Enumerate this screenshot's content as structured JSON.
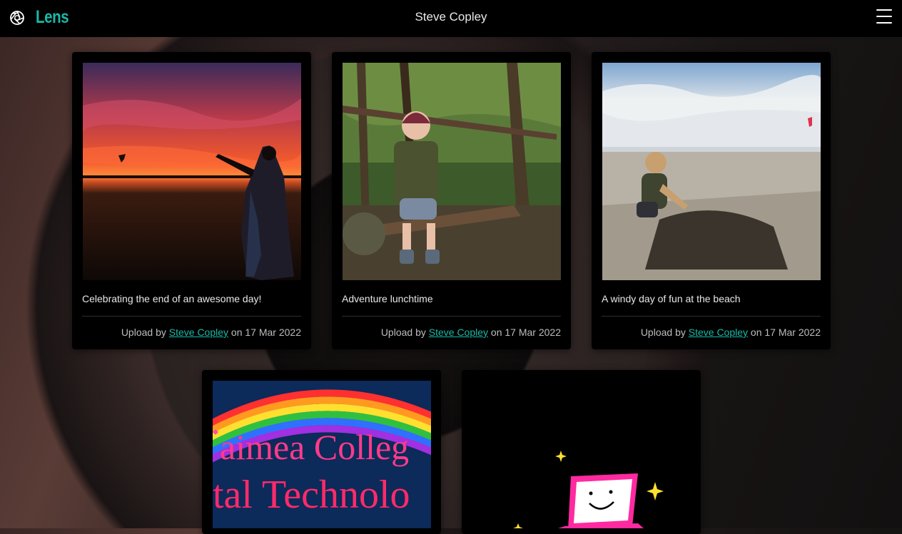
{
  "app": {
    "name": "Lens",
    "logo_icon": "aperture-icon",
    "accent": "#19b9a6"
  },
  "header": {
    "user_name": "Steve Copley",
    "menu_icon": "hamburger-menu-icon"
  },
  "posts": [
    {
      "caption": "Celebrating the end of an awesome day!",
      "upload_prefix": "Upload by",
      "author": "Steve Copley",
      "date_text": "on 17 Mar 2022",
      "image": "sunset-silhouette-photo"
    },
    {
      "caption": "Adventure lunchtime",
      "upload_prefix": "Upload by",
      "author": "Steve Copley",
      "date_text": "on 17 Mar 2022",
      "image": "child-in-forest-photo"
    },
    {
      "caption": "A windy day of fun at the beach",
      "upload_prefix": "Upload by",
      "author": "Steve Copley",
      "date_text": "on 17 Mar 2022",
      "image": "child-at-beach-photo"
    },
    {
      "image": "college-banner-image",
      "banner_line1": "aimea Colleg",
      "banner_line2": "tal Technolo"
    },
    {
      "image": "laptop-cartoon-image"
    }
  ]
}
